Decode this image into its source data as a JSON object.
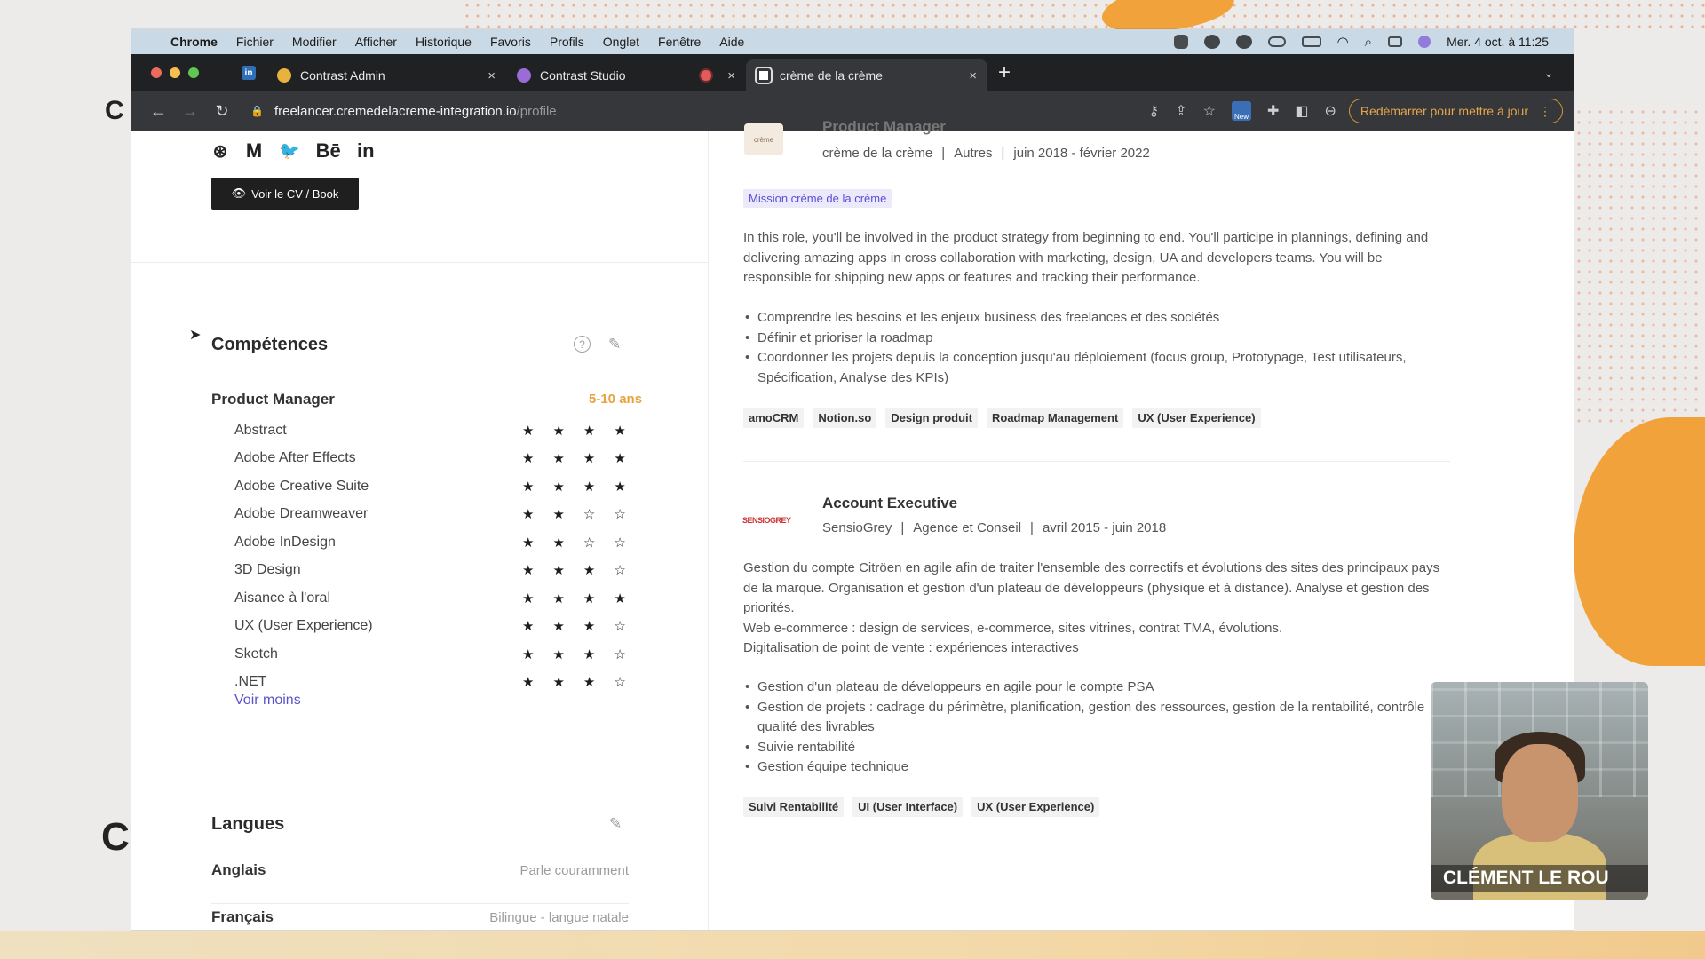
{
  "menubar": {
    "apple": "",
    "app": "Chrome",
    "items": [
      "Fichier",
      "Modifier",
      "Afficher",
      "Historique",
      "Favoris",
      "Profils",
      "Onglet",
      "Fenêtre",
      "Aide"
    ],
    "clock": "Mer. 4 oct. à 11:25"
  },
  "tabs": [
    {
      "label": "Contrast Admin",
      "close": "×"
    },
    {
      "label": "Contrast Studio",
      "close": "×"
    },
    {
      "label": "crème de la crème",
      "close": "×"
    }
  ],
  "pinned_tab": "in",
  "newtab": "+",
  "address": {
    "host": "freelancer.cremedelacreme-integration.io",
    "path": "/profile",
    "update_label": "Redémarrer pour mettre à jour",
    "ext_badge": "New"
  },
  "profile": {
    "socials": [
      "⊛",
      "M",
      "🐦",
      "Bē",
      "in"
    ],
    "cv_button": "Voir le CV / Book"
  },
  "competences": {
    "title": "Compétences",
    "help": "?",
    "role": "Product Manager",
    "years": "5-10 ans",
    "skills": [
      {
        "name": "Abstract",
        "rating": 4
      },
      {
        "name": "Adobe After Effects",
        "rating": 4
      },
      {
        "name": "Adobe Creative Suite",
        "rating": 4
      },
      {
        "name": "Adobe Dreamweaver",
        "rating": 2
      },
      {
        "name": "Adobe InDesign",
        "rating": 2
      },
      {
        "name": "3D Design",
        "rating": 3
      },
      {
        "name": "Aisance à l'oral",
        "rating": 4
      },
      {
        "name": "UX (User Experience)",
        "rating": 3
      },
      {
        "name": "Sketch",
        "rating": 3
      },
      {
        "name": ".NET",
        "rating": 3
      }
    ],
    "toggle": "Voir moins"
  },
  "langues": {
    "title": "Langues",
    "items": [
      {
        "name": "Anglais",
        "level": "Parle couramment"
      },
      {
        "name": "Français",
        "level": "Bilingue - langue natale"
      }
    ]
  },
  "experiences": [
    {
      "title": "Product Manager",
      "company": "crème de la crème",
      "sector": "Autres",
      "period": "juin 2018 - février 2022",
      "logo_text": "crème",
      "badge": "Mission crème de la crème",
      "description": "In this role, you'll be involved in the product strategy from beginning to end. You'll participe in plannings, defining and delivering amazing apps in cross collaboration with marketing, design, UA and developers teams. You will be responsible for shipping new apps or features and tracking their performance.",
      "bullets": [
        "Comprendre les besoins et les enjeux business des freelances et des sociétés",
        "Définir et prioriser la roadmap",
        "Coordonner les projets depuis la conception jusqu'au déploiement (focus group, Prototypage, Test utilisateurs, Spécification, Analyse des KPIs)"
      ],
      "tags": [
        "amoCRM",
        "Notion.so",
        "Design produit",
        "Roadmap Management",
        "UX (User Experience)"
      ]
    },
    {
      "title": "Account Executive",
      "company": "SensioGrey",
      "sector": "Agence et Conseil",
      "period": "avril 2015 - juin 2018",
      "logo_text": "SENSIOGREY",
      "description": "Gestion du compte Citröen en agile afin de traiter l'ensemble des correctifs et évolutions des sites des principaux pays de la marque. Organisation et gestion d'un plateau de développeurs (physique et à distance). Analyse et gestion des priorités.\nWeb e-commerce : design de services, e-commerce, sites vitrines, contrat TMA, évolutions.\nDigitalisation de point de vente : expériences interactives",
      "bullets": [
        "Gestion d'un plateau de développeurs en agile pour le compte PSA",
        "Gestion de projets : cadrage du périmètre, planification, gestion des ressources, gestion de la rentabilité, contrôle qualité des livrables",
        "Suivie rentabilité",
        "Gestion équipe technique"
      ],
      "tags": [
        "Suivi Rentabilité",
        "UI (User Interface)",
        "UX (User Experience)"
      ]
    }
  ],
  "webcam": {
    "caption": "CLÉMENT LE ROU"
  },
  "colors": {
    "accent_orange": "#f2a23a",
    "link_purple": "#5a54c8",
    "years_orange": "#e6a33e"
  },
  "side_letters": [
    "C",
    "C"
  ]
}
